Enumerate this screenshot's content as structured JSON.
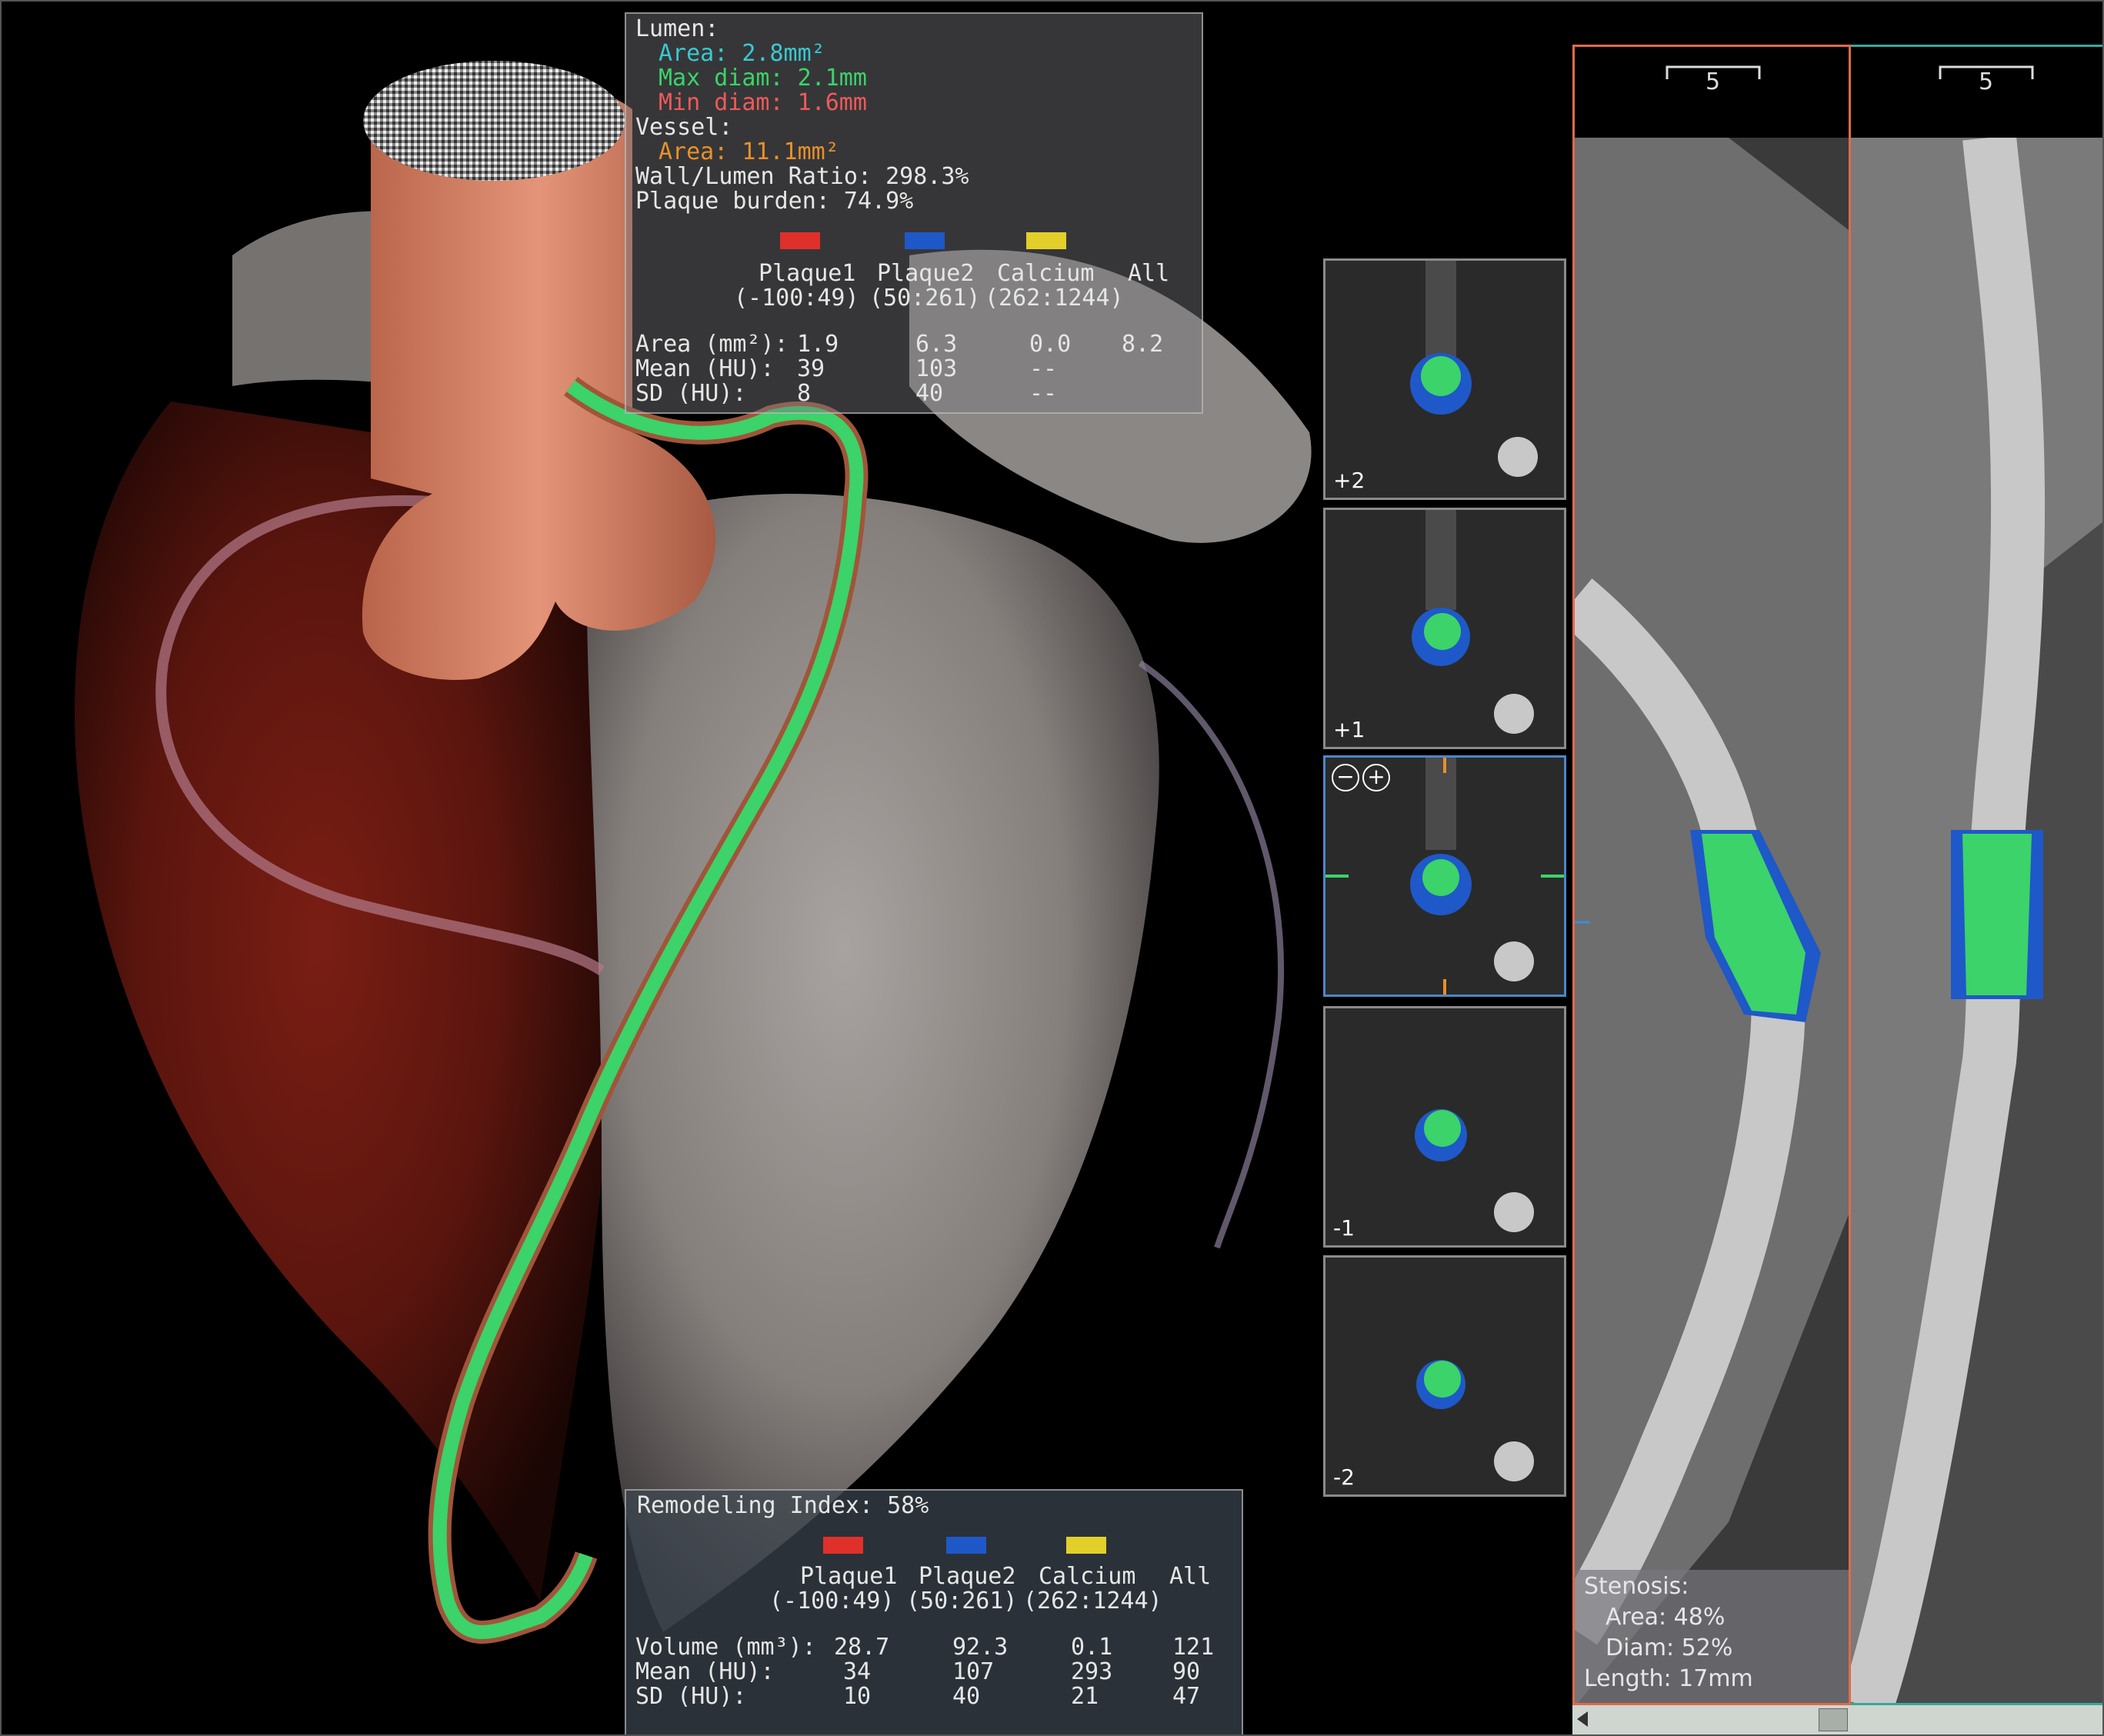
{
  "top_panel": {
    "lumen_title": "Lumen:",
    "lumen_area": "Area: 2.8mm²",
    "lumen_max": "Max diam: 2.1mm",
    "lumen_min": "Min diam: 1.6mm",
    "vessel_title": "Vessel:",
    "vessel_area": "Area: 11.1mm²",
    "wall_ratio": "Wall/Lumen Ratio: 298.3%",
    "plaque_burden": "Plaque burden: 74.9%",
    "headers": [
      "Plaque1",
      "Plaque2",
      "Calcium",
      "All"
    ],
    "ranges": [
      "(-100:49)",
      "(50:261)",
      "(262:1244)"
    ],
    "rows": [
      {
        "label": "Area (mm²):",
        "values": [
          "1.9",
          "6.3",
          "0.0",
          "8.2"
        ]
      },
      {
        "label": "Mean (HU):",
        "values": [
          "39",
          "103",
          "--",
          ""
        ]
      },
      {
        "label": "SD (HU):",
        "values": [
          "8",
          "40",
          "--",
          ""
        ]
      }
    ]
  },
  "bottom_panel": {
    "remodeling": "Remodeling Index: 58%",
    "headers": [
      "Plaque1",
      "Plaque2",
      "Calcium",
      "All"
    ],
    "ranges": [
      "(-100:49)",
      "(50:261)",
      "(262:1244)"
    ],
    "rows": [
      {
        "label": "Volume (mm³):",
        "values": [
          "28.7",
          "92.3",
          "0.1",
          "121"
        ]
      },
      {
        "label": "Mean (HU):",
        "values": [
          "34",
          "107",
          "293",
          "90"
        ]
      },
      {
        "label": "SD (HU):",
        "values": [
          "10",
          "40",
          "21",
          "47"
        ]
      }
    ]
  },
  "slices": [
    "+2",
    "+1",
    "",
    "-1",
    "-2"
  ],
  "zoom": {
    "minus": "−",
    "plus": "+"
  },
  "cpr": {
    "scale_left": "5",
    "scale_right": "5",
    "stenosis_title": "Stenosis:",
    "stenosis_area": "Area: 48%",
    "stenosis_diam": "Diam: 52%",
    "stenosis_length": "Length: 17mm"
  },
  "colors": {
    "plaque1": "#e0302a",
    "plaque2": "#1f58c8",
    "calcium": "#e3cf2a",
    "lumen_green": "#3bd36a",
    "lumen_cyan": "#39c9d0",
    "min_red": "#ef5a5a",
    "vessel_orange": "#e8902a"
  }
}
